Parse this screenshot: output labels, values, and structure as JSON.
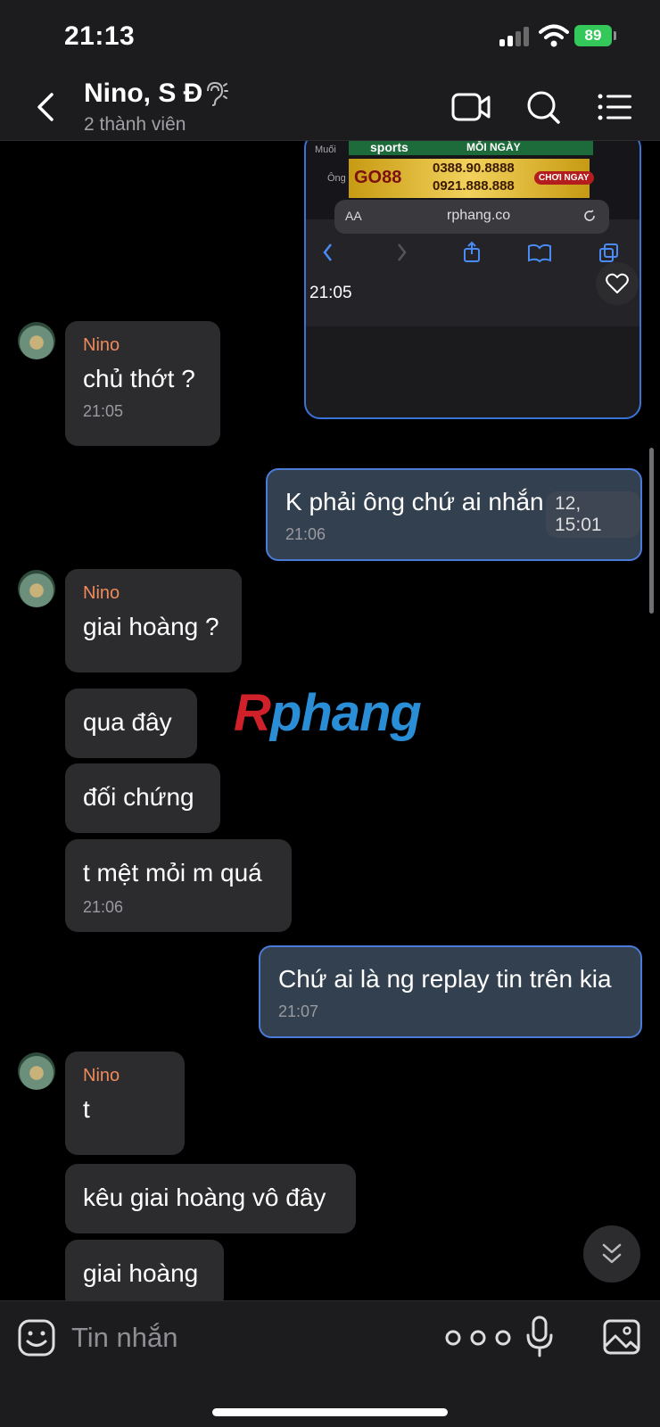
{
  "status_bar": {
    "time": "21:13",
    "battery": "89"
  },
  "header": {
    "title": "Nino, S Đ",
    "subtitle": "2 thành viên"
  },
  "screenshot_preview": {
    "banner_top": "sports",
    "banner_top_right": "MỖI NGÀY",
    "label_top": "Muối",
    "label_mid": "Ông",
    "brand": "GO88",
    "phone_1": "0388.90.8888",
    "phone_2": "0921.888.888",
    "cta": "CHƠI NGAY",
    "url_prefix": "AA",
    "url": "rphang.co",
    "time": "21:05"
  },
  "messages": [
    {
      "sender": "Nino",
      "text": "chủ thớt ?",
      "time": "21:05"
    },
    {
      "text": "K phải ông chứ ai nhắn tn kia",
      "time": "21:06",
      "overlay": "12, 15:01"
    },
    {
      "sender": "Nino",
      "text": "giai hoàng ?"
    },
    {
      "text": "qua đây"
    },
    {
      "text": "đối chứng"
    },
    {
      "text": "t mệt mỏi m quá",
      "time": "21:06"
    },
    {
      "text": "Chứ ai là ng replay tin trên kia",
      "time": "21:07"
    },
    {
      "sender": "Nino",
      "text": "t"
    },
    {
      "text": "kêu giai hoàng vô đây"
    },
    {
      "text": "giai hoàng"
    }
  ],
  "watermark": {
    "first": "R",
    "rest": "phang"
  },
  "input": {
    "placeholder": "Tin nhắn"
  },
  "colors": {
    "accent": "#4a7bd9",
    "sender": "#ef8a5a",
    "battery": "#34c759"
  }
}
